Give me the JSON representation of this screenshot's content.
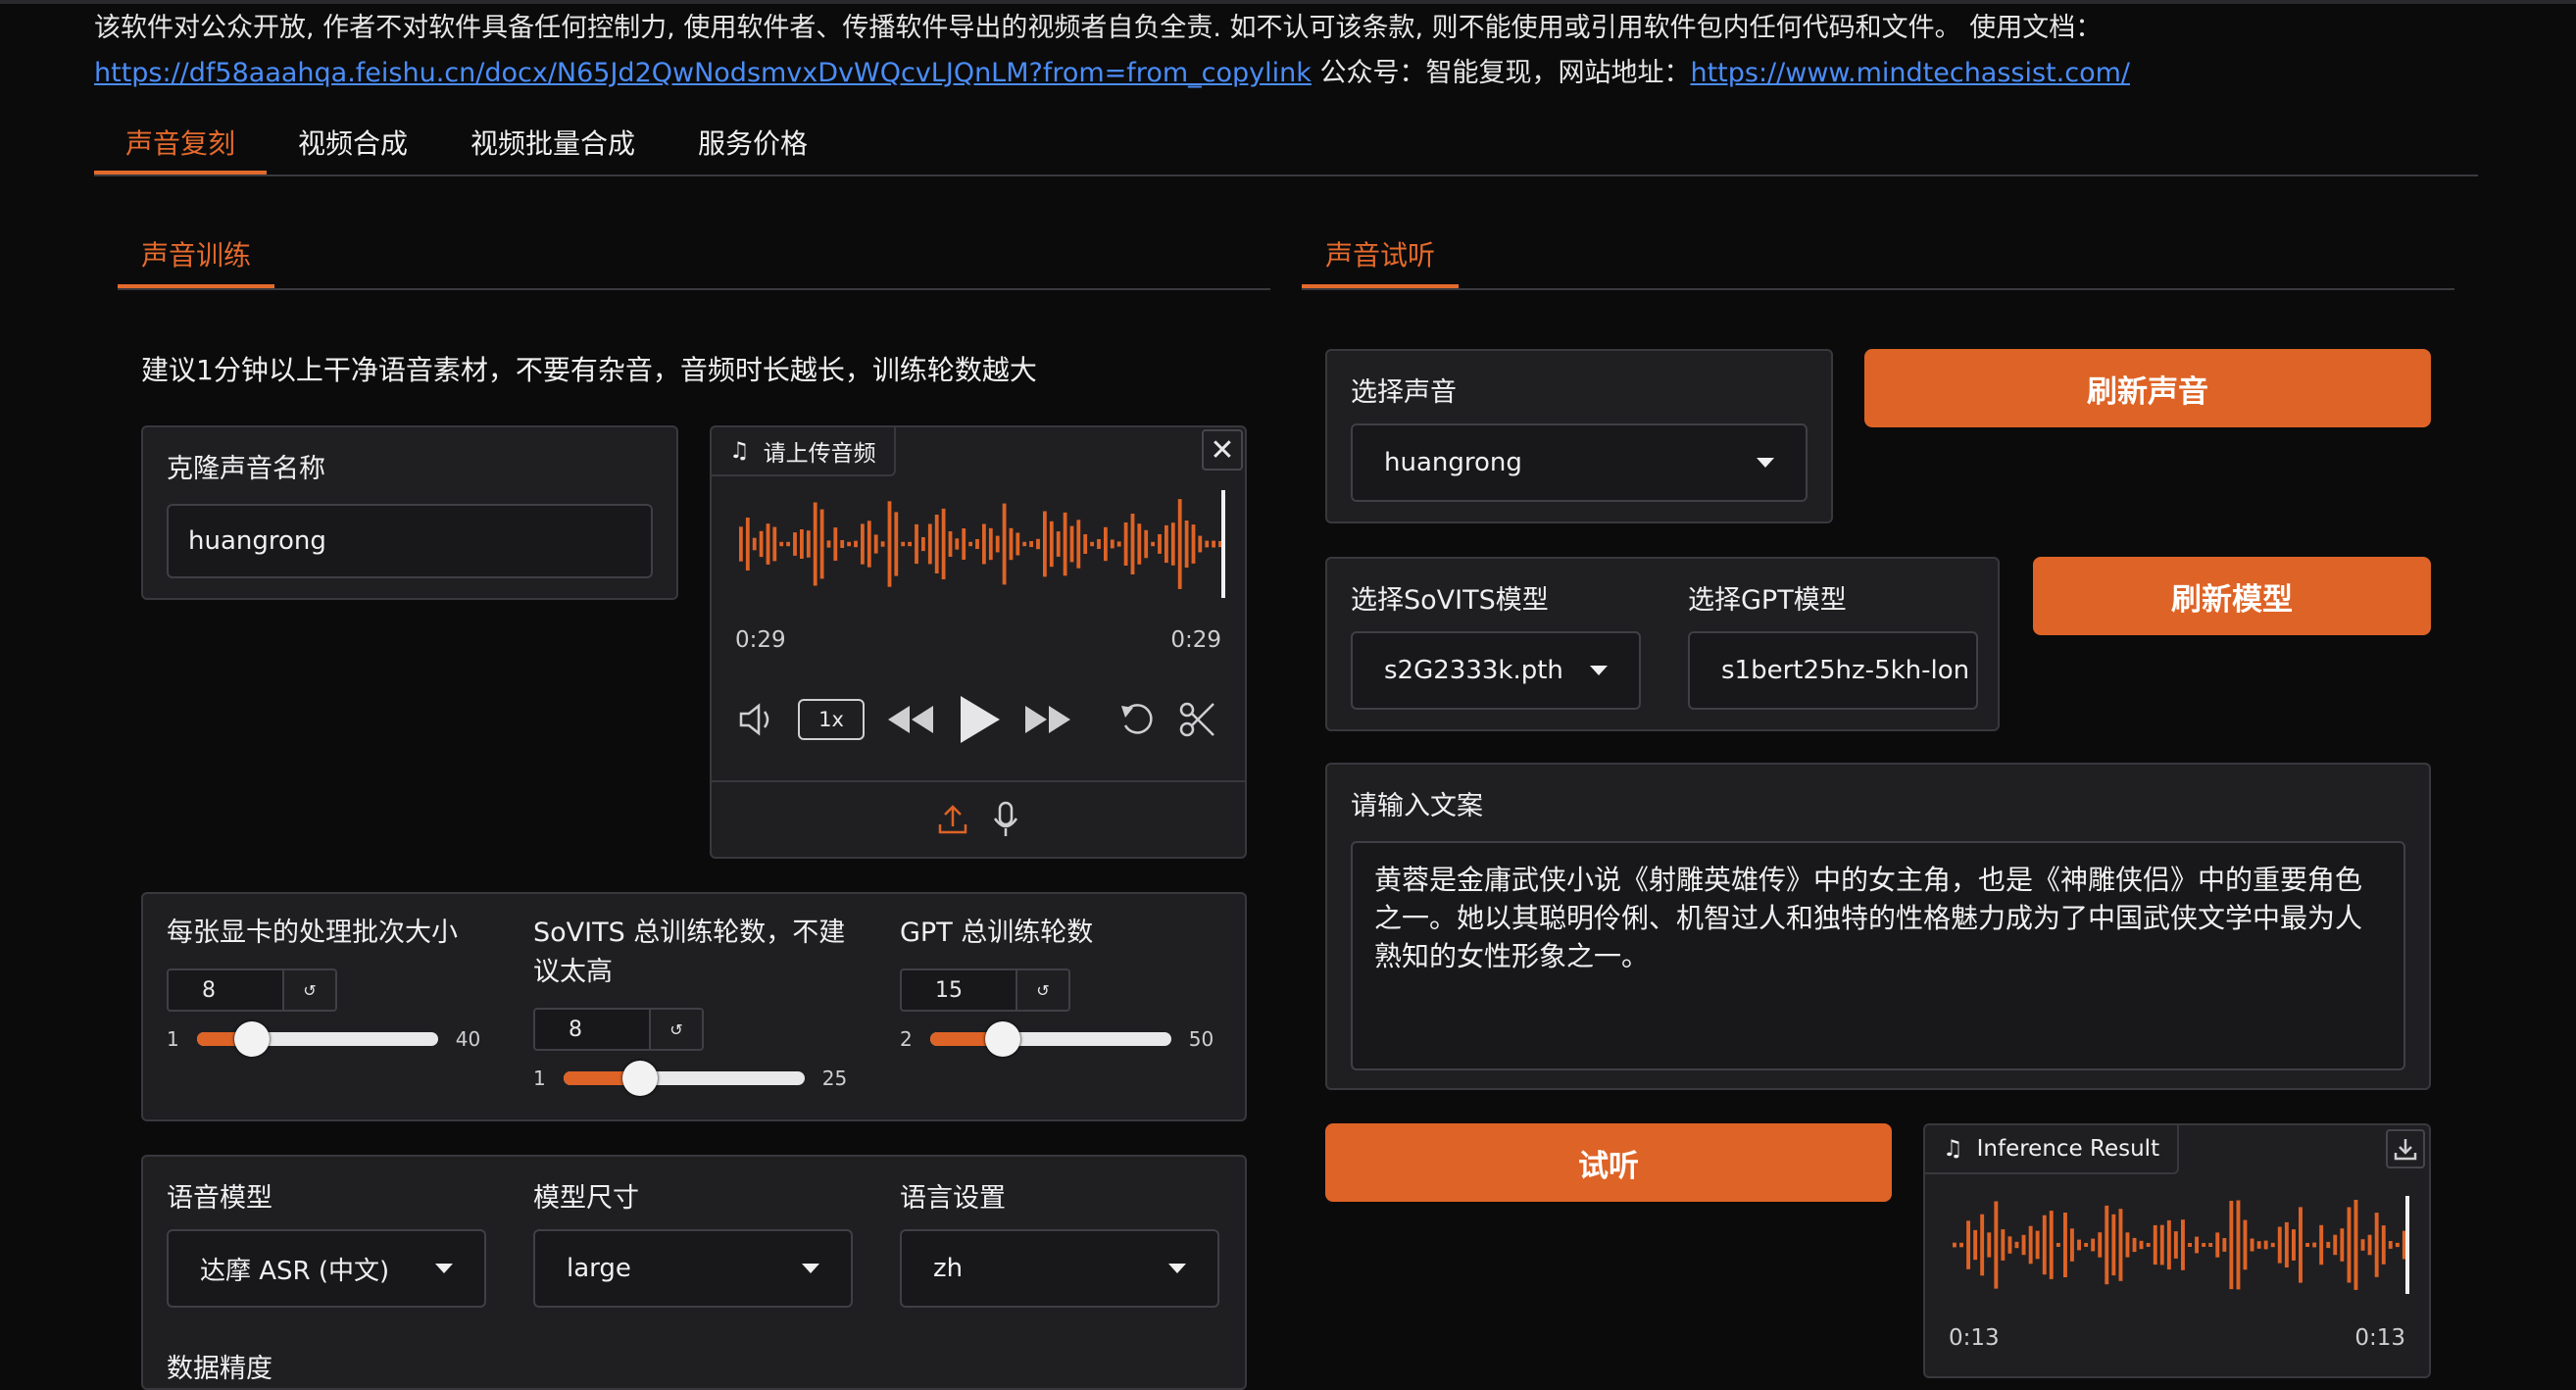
{
  "header": {
    "disclaimer": "该软件对公众开放, 作者不对软件具备任何控制力, 使用软件者、传播软件导出的视频者自负全责. 如不认可该条款, 则不能使用或引用软件包内任何代码和文件。 使用文档：",
    "doc_link": "https://df58aaahqa.feishu.cn/docx/N65Jd2QwNodsmvxDvWQcvLJQnLM?from=from_copylink",
    "wechat_text": " 公众号：智能复现，网站地址：",
    "site_link": "https://www.mindtechassist.com/"
  },
  "tabs": [
    {
      "label": "声音复刻",
      "active": true
    },
    {
      "label": "视频合成"
    },
    {
      "label": "视频批量合成"
    },
    {
      "label": "服务价格"
    }
  ],
  "training": {
    "tab": "声音训练",
    "hint": "建议1分钟以上干净语音素材，不要有杂音，音频时长越长，训练轮数越大",
    "name_label": "克隆声音名称",
    "name_value": "huangrong",
    "audio": {
      "header": "请上传音频",
      "time_left": "0:29",
      "time_right": "0:29",
      "speed": "1x"
    },
    "batch": {
      "label": "每张显卡的处理批次大小",
      "value": "8",
      "min": "1",
      "max": "40",
      "level": 7
    },
    "sovits": {
      "label": "SoVITS 总训练轮数，不建议太高",
      "value": "8",
      "min": "1",
      "max": "25",
      "level": 8
    },
    "gpt": {
      "label": "GPT 总训练轮数",
      "value": "15",
      "min": "2",
      "max": "50",
      "level": 15
    },
    "asr": {
      "label": "语音模型",
      "value": "达摩 ASR (中文)"
    },
    "size": {
      "label": "模型尺寸",
      "value": "large"
    },
    "lang": {
      "label": "语言设置",
      "value": "zh"
    },
    "precision_label": "数据精度"
  },
  "preview": {
    "tab": "声音试听",
    "voice_label": "选择声音",
    "voice_value": "huangrong",
    "refresh_voice": "刷新声音",
    "sovits_label": "选择SoVITS模型",
    "sovits_value": "s2G2333k.pth",
    "gpt_label": "选择GPT模型",
    "gpt_value": "s1bert25hz-5kh-lon",
    "refresh_model": "刷新模型",
    "text_label": "请输入文案",
    "text_value": "黄蓉是金庸武侠小说《射雕英雄传》中的女主角，也是《神雕侠侣》中的重要角色之一。她以其聪明伶俐、机智过人和独特的性格魅力成为了中国武侠文学中最为人熟知的女性形象之一。",
    "listen": "试听",
    "result": {
      "header": "Inference Result",
      "time_left": "0:13",
      "time_right": "0:13"
    }
  },
  "colors": {
    "accent": "#de6326",
    "link": "#4b8df8",
    "background": "#0b0b0c"
  }
}
